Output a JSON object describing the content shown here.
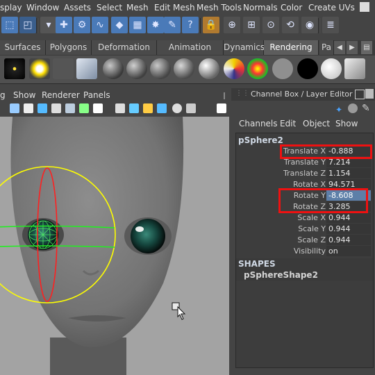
{
  "menu_bar": [
    "splay",
    "Window",
    "Assets",
    "Select",
    "Mesh",
    "Edit Mesh",
    "Mesh Tools",
    "Normals",
    "Color",
    "Create UVs"
  ],
  "toolbar_icons": [
    "select-tool-icon",
    "lasso-tool-icon",
    "dropdown-icon",
    "move-tool-icon",
    "joint-tool-icon",
    "curve-tool-icon",
    "plane-icon",
    "lattice-icon",
    "particles-icon",
    "paint-icon",
    "help-icon",
    "lock-icon",
    "snap-icon",
    "grid-snap-icon",
    "point-snap-icon",
    "history-icon",
    "render-icon",
    "channel-box-icon"
  ],
  "shelf_tabs": [
    {
      "label": "Surfaces",
      "active": false
    },
    {
      "label": "Polygons",
      "active": false
    },
    {
      "label": "Deformation",
      "active": false
    },
    {
      "label": "Animation",
      "active": false
    },
    {
      "label": "Dynamics",
      "active": false
    },
    {
      "label": "Rendering",
      "active": true
    },
    {
      "label": "Pa",
      "active": false
    }
  ],
  "shelf_items": [
    "light-icon",
    "sun-icon",
    "camera-icon",
    "image-icon",
    "material-ball-dark",
    "material-ball-gray",
    "material-ball-gray2",
    "material-ball-gray3",
    "material-ball-light",
    "material-ball-colorful",
    "material-ball-rainbow",
    "material-ball-plain",
    "material-ball-black",
    "material-ball-white",
    "render-settings-icon"
  ],
  "viewport": {
    "panel_menu": [
      "g",
      "Show",
      "Renderer",
      "Panels"
    ],
    "colors": {
      "face": "#7e7e7e",
      "background": "#a3a3a3",
      "manipulator_yellow": "#ffff00",
      "manipulator_red": "#ff2020",
      "manipulator_green": "#22ee22"
    }
  },
  "channel_box": {
    "title": "Channel Box / Layer Editor",
    "menu": [
      "Channels",
      "Edit",
      "Object",
      "Show"
    ],
    "object_name": "pSphere2",
    "attributes": [
      {
        "label": "Translate X",
        "value": "-0.888",
        "selected": false
      },
      {
        "label": "Translate Y",
        "value": "7.214",
        "selected": false
      },
      {
        "label": "Translate Z",
        "value": "1.154",
        "selected": false
      },
      {
        "label": "Rotate X",
        "value": "94.571",
        "selected": false
      },
      {
        "label": "Rotate Y",
        "value": "-8.608",
        "selected": true
      },
      {
        "label": "Rotate Z",
        "value": "3.285",
        "selected": false
      },
      {
        "label": "Scale X",
        "value": "0.944",
        "selected": false
      },
      {
        "label": "Scale Y",
        "value": "0.944",
        "selected": false
      },
      {
        "label": "Scale Z",
        "value": "0.944",
        "selected": false
      },
      {
        "label": "Visibility",
        "value": "on",
        "selected": false
      }
    ],
    "shapes_header": "SHAPES",
    "shape_name": "pSphereShape2"
  },
  "highlight_color": "#ee1111"
}
